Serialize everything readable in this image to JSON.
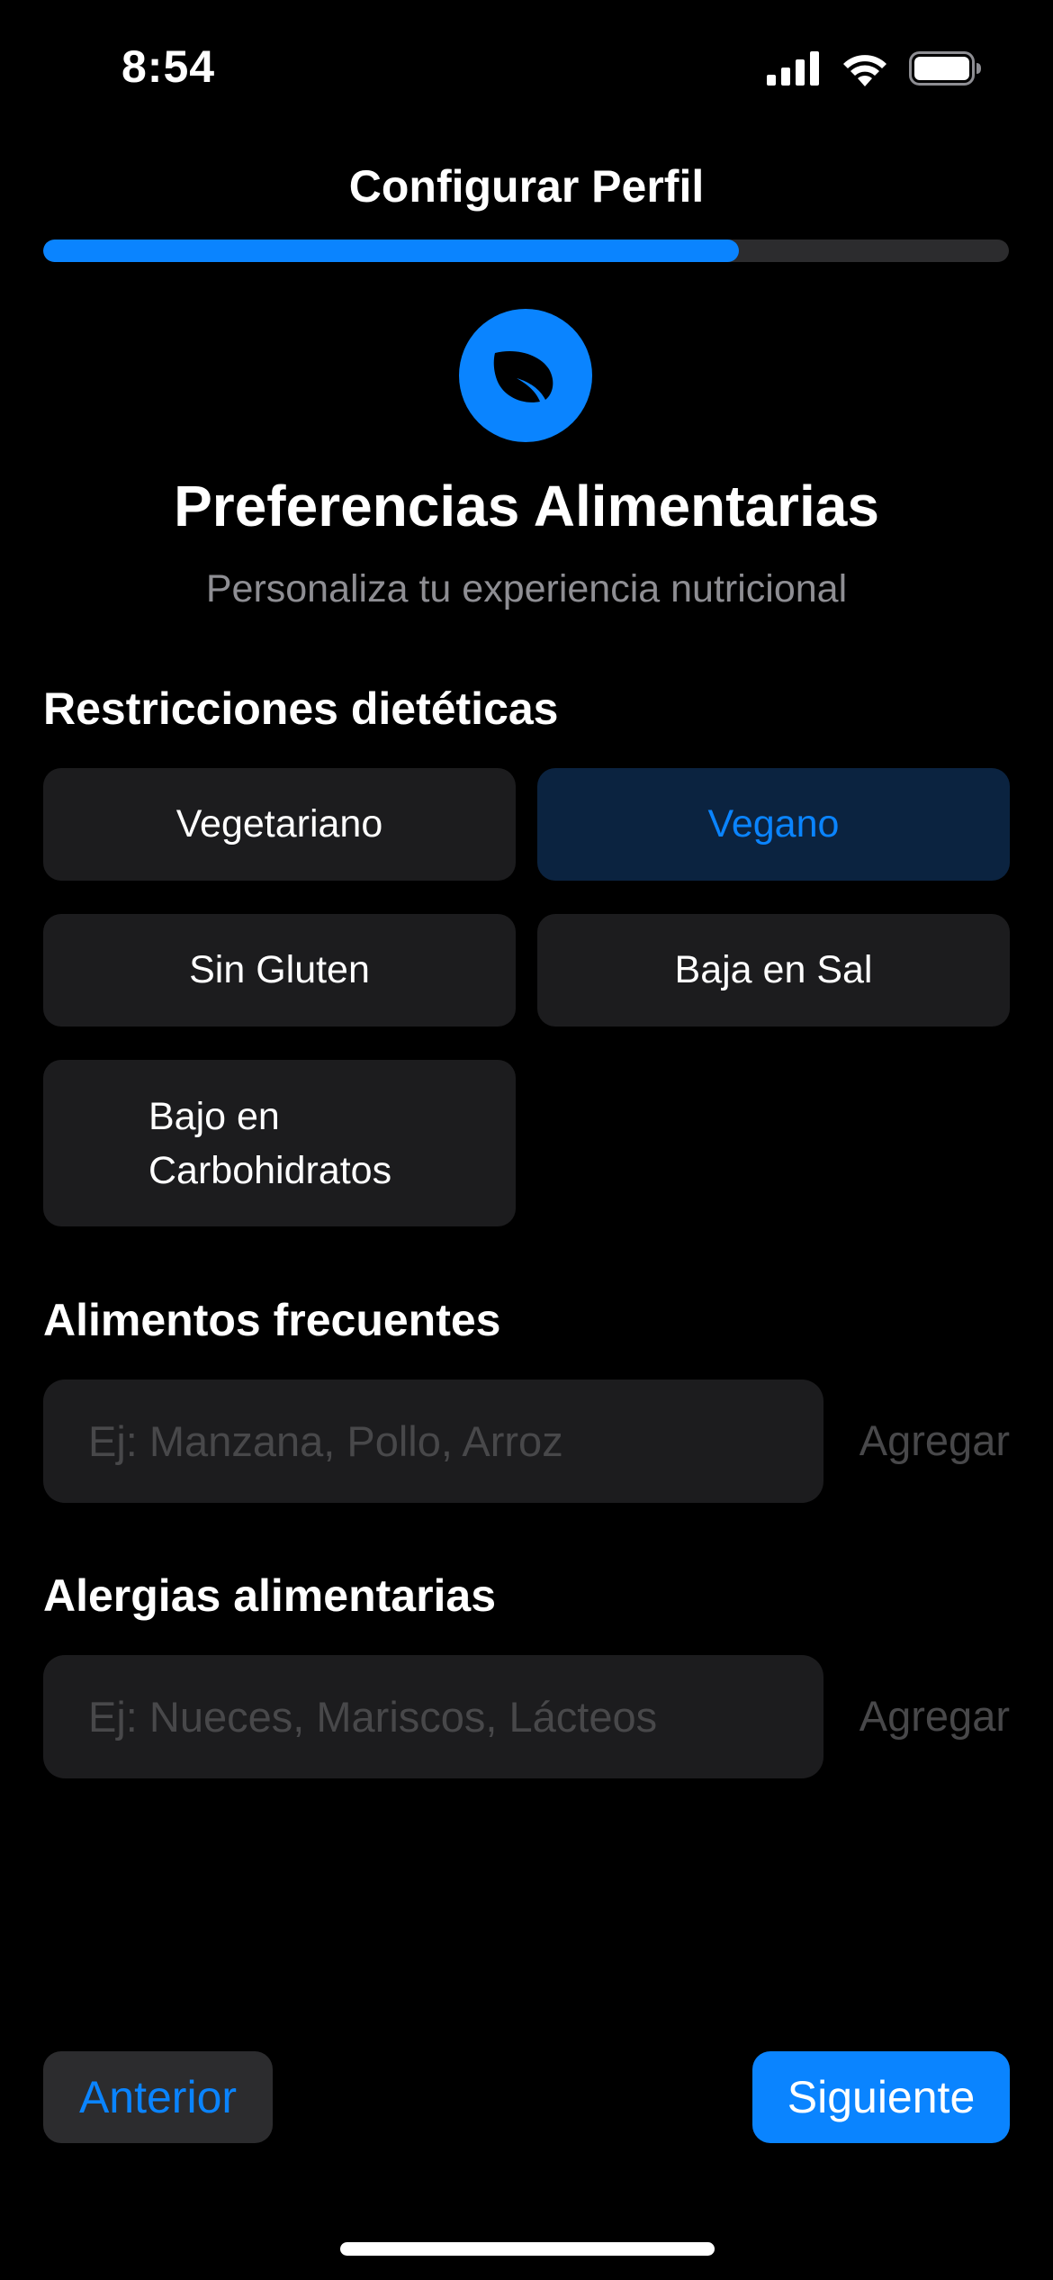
{
  "status_bar": {
    "time": "8:54"
  },
  "header": {
    "title": "Configurar Perfil",
    "progress": 0.72
  },
  "hero": {
    "icon": "leaf-icon",
    "title": "Preferencias Alimentarias",
    "subtitle": "Personaliza tu experiencia nutricional"
  },
  "restrictions": {
    "title": "Restricciones dietéticas",
    "options": [
      {
        "label": "Vegetariano",
        "selected": false
      },
      {
        "label": "Vegano",
        "selected": true
      },
      {
        "label": "Sin Gluten",
        "selected": false
      },
      {
        "label": "Baja en Sal",
        "selected": false
      },
      {
        "label": "Bajo en Carbohidratos",
        "selected": false
      }
    ]
  },
  "frequent_foods": {
    "title": "Alimentos frecuentes",
    "placeholder": "Ej: Manzana, Pollo, Arroz",
    "value": "",
    "add_label": "Agregar"
  },
  "allergies": {
    "title": "Alergias alimentarias",
    "placeholder": "Ej: Nueces, Mariscos, Lácteos",
    "value": "",
    "add_label": "Agregar"
  },
  "footer": {
    "prev_label": "Anterior",
    "next_label": "Siguiente"
  },
  "colors": {
    "accent": "#0a84ff",
    "background": "#000000",
    "card": "#1c1c1e",
    "selected_card": "#0b2340",
    "secondary_text": "#8e8e93"
  }
}
